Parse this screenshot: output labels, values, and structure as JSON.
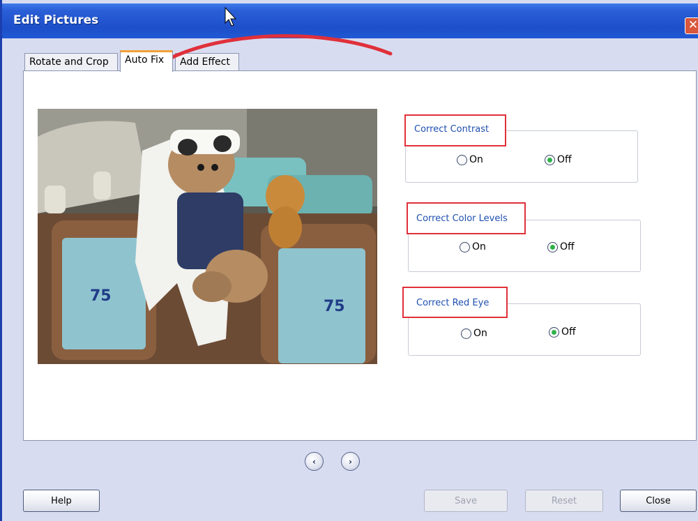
{
  "window": {
    "title": "Edit Pictures",
    "close_glyph": "✕"
  },
  "tabs": [
    {
      "label": "Rotate and Crop",
      "active": false
    },
    {
      "label": "Auto Fix",
      "active": true
    },
    {
      "label": "Add Effect",
      "active": false
    }
  ],
  "photo": {
    "description_icon": "teddy-bear-photo"
  },
  "groups": [
    {
      "label": "Correct Contrast",
      "on_label": "On",
      "off_label": "Off",
      "selected": "Off"
    },
    {
      "label": "Correct Color Levels",
      "on_label": "On",
      "off_label": "Off",
      "selected": "Off"
    },
    {
      "label": "Correct Red Eye",
      "on_label": "On",
      "off_label": "Off",
      "selected": "Off"
    }
  ],
  "nav": {
    "prev_glyph": "‹",
    "next_glyph": "›"
  },
  "buttons": {
    "help": "Help",
    "save": "Save",
    "reset": "Reset",
    "close": "Close"
  },
  "colors": {
    "titlebar": "#2a5fd8",
    "annotation": "#e0303a",
    "tab_accent": "#f3a033",
    "radio_selected": "#2db34a"
  }
}
